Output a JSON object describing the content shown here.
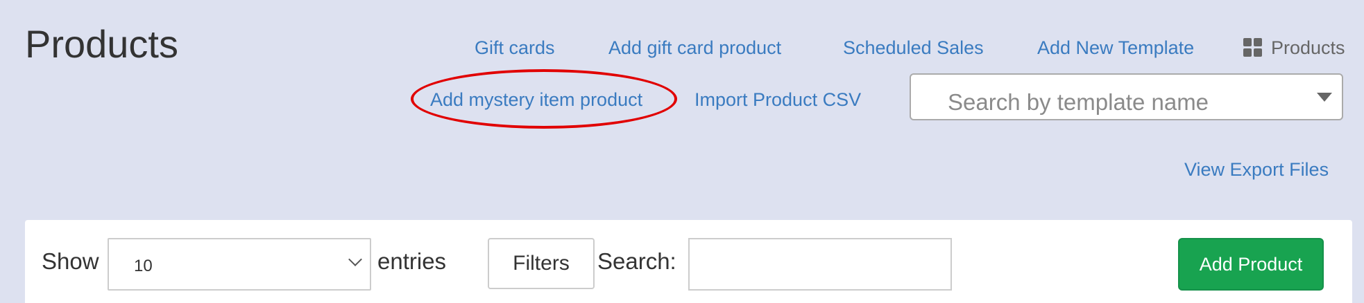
{
  "page": {
    "title": "Products"
  },
  "header_links": {
    "gift_cards": "Gift cards",
    "add_gift_card_product": "Add gift card product",
    "scheduled_sales": "Scheduled Sales",
    "add_new_template": "Add New Template",
    "add_mystery_item_product": "Add mystery item product",
    "import_product_csv": "Import Product CSV",
    "view_export_files": "View Export Files"
  },
  "breadcrumb": {
    "icon": "grid-icon",
    "label": "Products"
  },
  "template_search": {
    "placeholder": "Search by template name"
  },
  "table_controls": {
    "show_label": "Show",
    "entries_value": "10",
    "entries_label": "entries",
    "filters_label": "Filters",
    "search_label": "Search:",
    "search_value": "",
    "add_product_label": "Add Product"
  },
  "colors": {
    "background": "#dde1f0",
    "link": "#3a7bc0",
    "highlight": "#e10000",
    "add_product": "#18a350"
  }
}
